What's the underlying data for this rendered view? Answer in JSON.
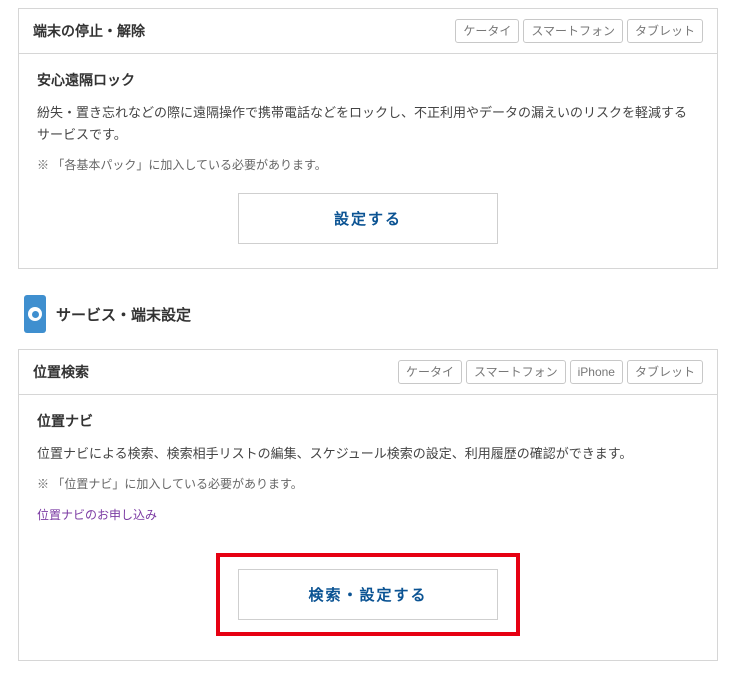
{
  "card1": {
    "header_title": "端末の停止・解除",
    "badges": [
      "ケータイ",
      "スマートフォン",
      "タブレット"
    ],
    "sub_title": "安心遠隔ロック",
    "desc": "紛失・置き忘れなどの際に遠隔操作で携帯電話などをロックし、不正利用やデータの漏えいのリスクを軽減するサービスです。",
    "note": "※ 「各基本パック」に加入している必要があります。",
    "button_label": "設定する"
  },
  "section_heading": "サービス・端末設定",
  "card2": {
    "header_title": "位置検索",
    "badges": [
      "ケータイ",
      "スマートフォン",
      "iPhone",
      "タブレット"
    ],
    "sub_title": "位置ナビ",
    "desc": "位置ナビによる検索、検索相手リストの編集、スケジュール検索の設定、利用履歴の確認ができます。",
    "note": "※ 「位置ナビ」に加入している必要があります。",
    "apply_link": "位置ナビのお申し込み",
    "button_label": "検索・設定する"
  }
}
